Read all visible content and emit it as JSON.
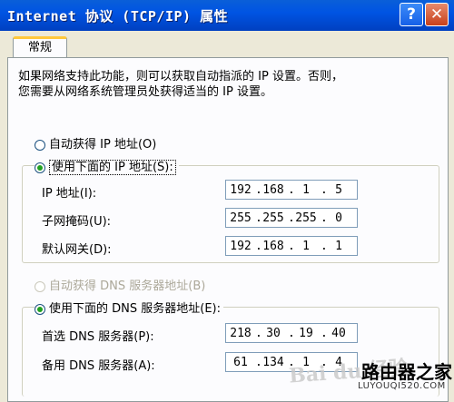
{
  "window": {
    "title": "Internet 协议 (TCP/IP) 属性",
    "help_glyph": "?",
    "close_glyph": "✕"
  },
  "tab": {
    "label": "常规"
  },
  "description": {
    "line1": "如果网络支持此功能，则可以获取自动指派的 IP 设置。否则，",
    "line2": "您需要从网络系统管理员处获得适当的 IP 设置。"
  },
  "ip_section": {
    "auto_label": "自动获得 IP 地址(O)",
    "manual_label": "使用下面的 IP 地址(S):",
    "selected": "manual",
    "fields": [
      {
        "label": "IP 地址(I):",
        "octets": [
          "192",
          "168",
          "1",
          "5"
        ]
      },
      {
        "label": "子网掩码(U):",
        "octets": [
          "255",
          "255",
          "255",
          "0"
        ]
      },
      {
        "label": "默认网关(D):",
        "octets": [
          "192",
          "168",
          "1",
          "1"
        ]
      }
    ]
  },
  "dns_section": {
    "auto_label": "自动获得 DNS 服务器地址(B)",
    "manual_label": "使用下面的 DNS 服务器地址(E):",
    "selected": "manual",
    "fields": [
      {
        "label": "首选 DNS 服务器(P):",
        "octets": [
          "218",
          "30",
          "19",
          "40"
        ]
      },
      {
        "label": "备用 DNS 服务器(A):",
        "octets": [
          "61",
          "134",
          "1",
          "4"
        ]
      }
    ]
  },
  "branding": {
    "watermark": "Bai du 经验",
    "logo": "路由器之家",
    "url": "LUYOUQI520.COM"
  }
}
